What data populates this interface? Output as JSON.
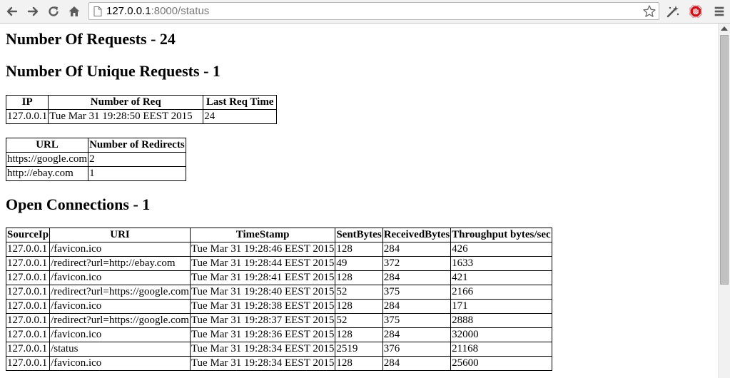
{
  "browser": {
    "url_host": "127.0.0.1",
    "url_rest": ":8000/status"
  },
  "page": {
    "requests_heading": "Number Of Requests - 24",
    "unique_heading": "Number Of Unique Requests - 1",
    "connections_heading": "Open Connections - 1"
  },
  "unique_table": {
    "headers": [
      "IP",
      "Number of Req",
      "Last Req Time"
    ],
    "rows": [
      [
        "127.0.0.1",
        "Tue Mar 31 19:28:50 EEST 2015",
        "24"
      ]
    ]
  },
  "redirect_table": {
    "headers": [
      "URL",
      "Number of Redirects"
    ],
    "rows": [
      [
        "https://google.com",
        "2"
      ],
      [
        "http://ebay.com",
        "1"
      ]
    ]
  },
  "connections_table": {
    "headers": [
      "SourceIp",
      "URI",
      "TimeStamp",
      "SentBytes",
      "ReceivedBytes",
      "Throughput bytes/sec"
    ],
    "rows": [
      [
        "127.0.0.1",
        "/favicon.ico",
        "Tue Mar 31 19:28:46 EEST 2015",
        "128",
        "284",
        "426"
      ],
      [
        "127.0.0.1",
        "/redirect?url=http://ebay.com",
        "Tue Mar 31 19:28:44 EEST 2015",
        "49",
        "372",
        "1633"
      ],
      [
        "127.0.0.1",
        "/favicon.ico",
        "Tue Mar 31 19:28:41 EEST 2015",
        "128",
        "284",
        "421"
      ],
      [
        "127.0.0.1",
        "/redirect?url=https://google.com",
        "Tue Mar 31 19:28:40 EEST 2015",
        "52",
        "375",
        "2166"
      ],
      [
        "127.0.0.1",
        "/favicon.ico",
        "Tue Mar 31 19:28:38 EEST 2015",
        "128",
        "284",
        "171"
      ],
      [
        "127.0.0.1",
        "/redirect?url=https://google.com",
        "Tue Mar 31 19:28:37 EEST 2015",
        "52",
        "375",
        "2888"
      ],
      [
        "127.0.0.1",
        "/favicon.ico",
        "Tue Mar 31 19:28:36 EEST 2015",
        "128",
        "284",
        "32000"
      ],
      [
        "127.0.0.1",
        "/status",
        "Tue Mar 31 19:28:34 EEST 2015",
        "2519",
        "376",
        "21168"
      ],
      [
        "127.0.0.1",
        "/favicon.ico",
        "Tue Mar 31 19:28:34 EEST 2015",
        "128",
        "284",
        "25600"
      ]
    ]
  },
  "icons": {
    "back": "back-arrow-icon",
    "forward": "forward-arrow-icon",
    "reload": "reload-icon",
    "home": "home-icon",
    "page": "page-icon",
    "star": "star-icon",
    "extension_1": "magic-wand-icon",
    "extension_2": "stop-sign-icon",
    "menu": "hamburger-menu-icon"
  },
  "colors": {
    "toolbar": "#f2f2f2",
    "icon": "#5a5a5a",
    "stop_red": "#d0121b"
  }
}
